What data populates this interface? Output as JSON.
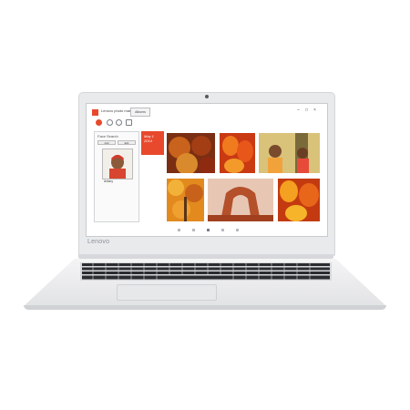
{
  "brand": "Lenovo",
  "colors": {
    "accent": "#e8492c",
    "bezel": "#e9eaec",
    "keys": "#2a2c30"
  },
  "app": {
    "title": "Lenovo photo master",
    "tab_label": "Albums",
    "window_controls": [
      "minimize-icon",
      "maximize-icon",
      "close-icon"
    ],
    "toolbar_icons": [
      "person-icon",
      "location-pin-icon",
      "clock-icon",
      "filter-icon"
    ],
    "face_panel": {
      "title": "Face Search",
      "buttons": [
        "Add",
        "Edit"
      ],
      "person_name": "Antony"
    },
    "date_tile": {
      "date": "May 1",
      "year": "2014"
    },
    "photos": [
      "spices",
      "peppers",
      "children",
      "autumn-tree",
      "rock-arch",
      "tulips"
    ]
  }
}
